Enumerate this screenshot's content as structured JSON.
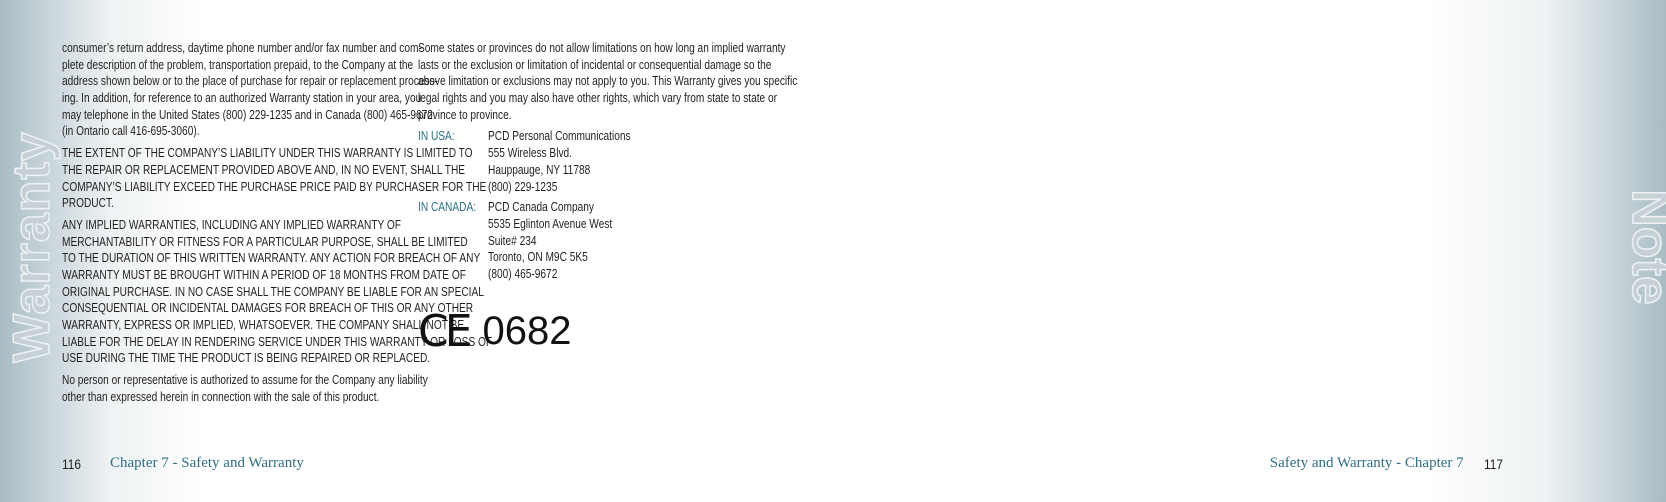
{
  "side_tabs": {
    "left": "Warranty",
    "right": "Note"
  },
  "left_column": {
    "paragraphs": [
      [
        "consumer’s return address, daytime phone number and/or fax number and com-",
        "plete description of the problem, transportation prepaid, to the Company at the",
        "address shown below or to the place of purchase for repair or replacement process-",
        "ing. In addition, for reference to an authorized Warranty station in your area, you",
        "may telephone in the United States (800) 229-1235 and in Canada (800) 465-9672",
        "(in Ontario call 416-695-3060)."
      ],
      [
        "THE EXTENT OF THE COMPANY’S LIABILITY UNDER THIS WARRANTY IS LIMITED TO",
        "THE REPAIR OR REPLACEMENT PROVIDED ABOVE AND, IN NO EVENT, SHALL THE",
        "COMPANY’S LIABILITY EXCEED THE PURCHASE PRICE PAID BY PURCHASER FOR THE",
        "PRODUCT."
      ],
      [
        "ANY IMPLIED WARRANTIES, INCLUDING ANY IMPLIED WARRANTY OF",
        "MERCHANTABILITY OR FITNESS FOR A PARTICULAR PURPOSE, SHALL BE LIMITED",
        "TO THE DURATION OF THIS WRITTEN WARRANTY. ANY ACTION FOR BREACH OF ANY",
        "WARRANTY MUST BE BROUGHT WITHIN A PERIOD OF 18 MONTHS FROM DATE OF",
        "ORIGINAL PURCHASE. IN NO CASE SHALL THE COMPANY BE LIABLE FOR AN SPECIAL",
        "CONSEQUENTIAL OR INCIDENTAL DAMAGES FOR BREACH OF THIS OR ANY OTHER",
        "WARRANTY, EXPRESS OR IMPLIED, WHATSOEVER. THE COMPANY SHALL NOT BE",
        "LIABLE FOR THE DELAY IN RENDERING SERVICE UNDER THIS WARRANTY OR LOSS OF",
        "USE DURING THE TIME THE PRODUCT IS BEING REPAIRED OR REPLACED."
      ],
      [
        "No person or representative is authorized to assume for the Company any liability",
        "other than expressed herein in connection with the sale of this product."
      ]
    ]
  },
  "right_column": {
    "paragraph": [
      "Some states or provinces do not allow limitations on how long an implied warranty",
      "lasts or the exclusion or limitation of incidental or consequential damage so the",
      "above limitation or exclusions may not apply to you. This Warranty gives you specific",
      "legal rights and you may also have other rights, which vary from state to state or",
      "province to province."
    ],
    "addresses": [
      {
        "label": "IN USA:",
        "lines": [
          "PCD Personal Communications",
          "555 Wireless Blvd.",
          "Hauppauge, NY 11788",
          "(800) 229-1235"
        ]
      },
      {
        "label": "IN CANADA:",
        "lines": [
          "PCD Canada Company",
          "5535 Eglinton Avenue West",
          "Suite# 234",
          "Toronto, ON M9C 5K5",
          "(800) 465-9672"
        ]
      }
    ],
    "ce_mark": "CE",
    "ce_number": "0682"
  },
  "footer": {
    "left": {
      "page": "116",
      "chapter": "Chapter 7 - Safety and Warranty"
    },
    "right": {
      "page": "117",
      "chapter": "Safety and Warranty - Chapter 7"
    }
  },
  "colors": {
    "accent": "#2d6f86",
    "tab": "#c6d1d6"
  }
}
